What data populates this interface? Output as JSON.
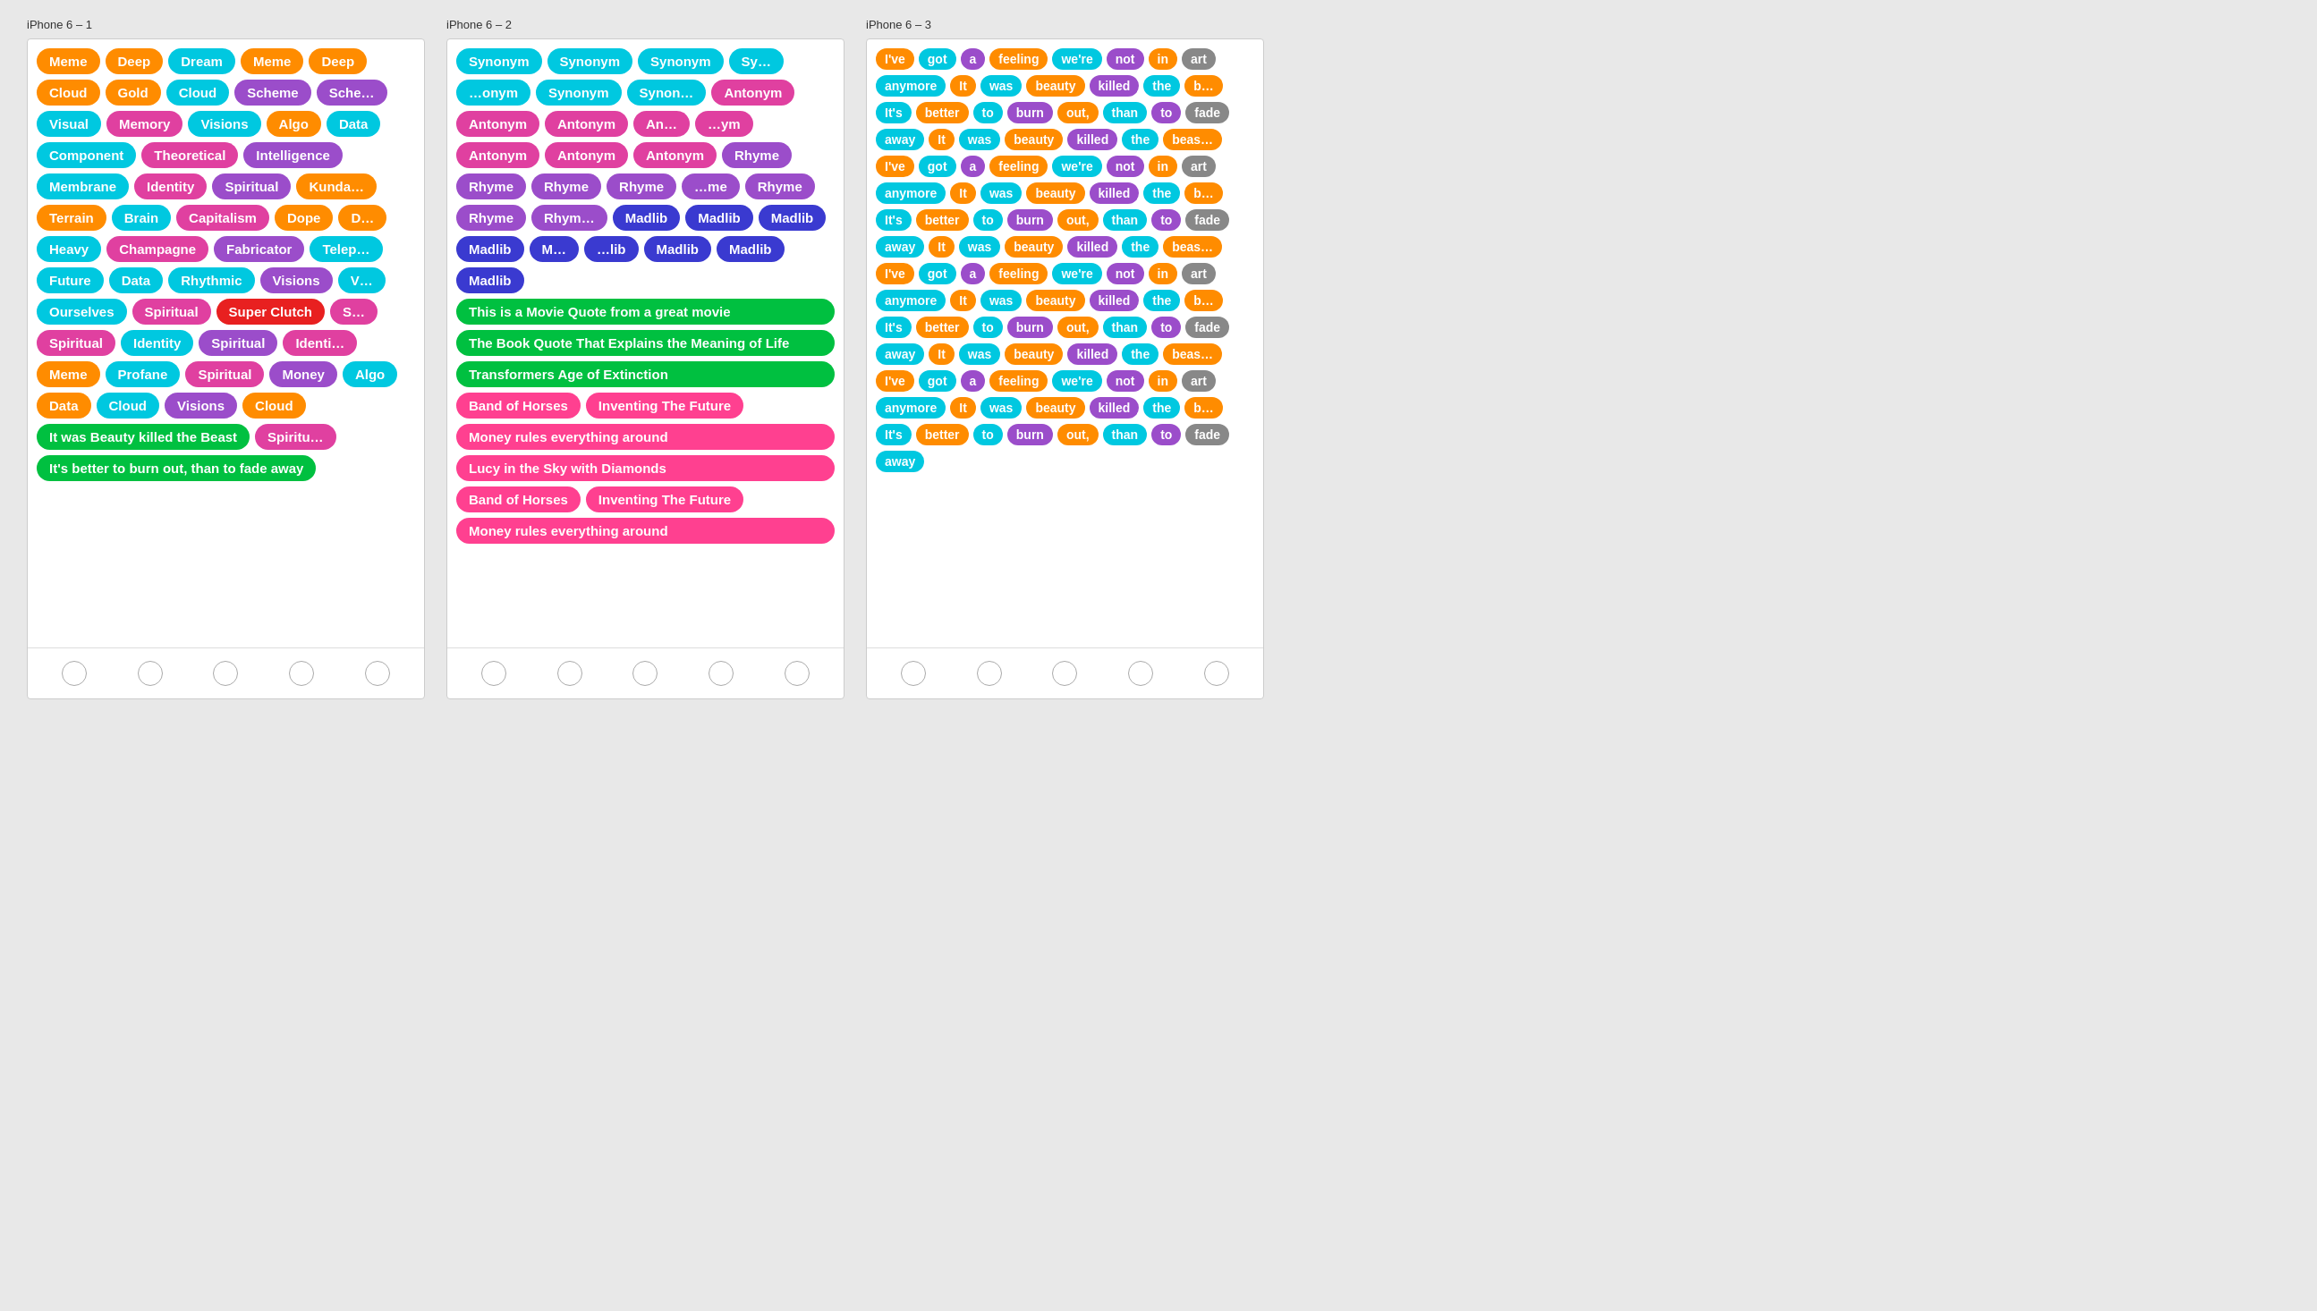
{
  "phones": [
    {
      "label": "iPhone 6 – 1",
      "tags": [
        {
          "text": "Meme",
          "color": "orange"
        },
        {
          "text": "Deep",
          "color": "orange"
        },
        {
          "text": "Dream",
          "color": "cyan"
        },
        {
          "text": "Meme",
          "color": "orange"
        },
        {
          "text": "Deep",
          "color": "orange"
        },
        {
          "text": "Cloud",
          "color": "orange"
        },
        {
          "text": "Gold",
          "color": "orange"
        },
        {
          "text": "Cloud",
          "color": "cyan"
        },
        {
          "text": "Scheme",
          "color": "purple"
        },
        {
          "text": "Sche…",
          "color": "purple"
        },
        {
          "text": "Visual",
          "color": "cyan"
        },
        {
          "text": "Memory",
          "color": "magenta"
        },
        {
          "text": "Visions",
          "color": "cyan"
        },
        {
          "text": "Algo",
          "color": "orange"
        },
        {
          "text": "Data",
          "color": "cyan"
        },
        {
          "text": "Component",
          "color": "cyan"
        },
        {
          "text": "Theoretical",
          "color": "magenta"
        },
        {
          "text": "Intelligence",
          "color": "purple"
        },
        {
          "text": "Membrane",
          "color": "cyan"
        },
        {
          "text": "Identity",
          "color": "magenta"
        },
        {
          "text": "Spiritual",
          "color": "purple"
        },
        {
          "text": "Kunda…",
          "color": "orange"
        },
        {
          "text": "Terrain",
          "color": "orange"
        },
        {
          "text": "Brain",
          "color": "cyan"
        },
        {
          "text": "Capitalism",
          "color": "magenta"
        },
        {
          "text": "Dope",
          "color": "orange"
        },
        {
          "text": "D…",
          "color": "orange"
        },
        {
          "text": "Heavy",
          "color": "cyan"
        },
        {
          "text": "Champagne",
          "color": "magenta"
        },
        {
          "text": "Fabricator",
          "color": "purple"
        },
        {
          "text": "Telep…",
          "color": "cyan"
        },
        {
          "text": "Future",
          "color": "cyan"
        },
        {
          "text": "Data",
          "color": "cyan"
        },
        {
          "text": "Rhythmic",
          "color": "cyan"
        },
        {
          "text": "Visions",
          "color": "purple"
        },
        {
          "text": "V…",
          "color": "cyan"
        },
        {
          "text": "Ourselves",
          "color": "cyan"
        },
        {
          "text": "Spiritual",
          "color": "magenta"
        },
        {
          "text": "Super Clutch",
          "color": "red"
        },
        {
          "text": "S…",
          "color": "magenta"
        },
        {
          "text": "Spiritual",
          "color": "magenta"
        },
        {
          "text": "Identity",
          "color": "cyan"
        },
        {
          "text": "Spiritual",
          "color": "purple"
        },
        {
          "text": "Identi…",
          "color": "magenta"
        },
        {
          "text": "Meme",
          "color": "orange"
        },
        {
          "text": "Profane",
          "color": "cyan"
        },
        {
          "text": "Spiritual",
          "color": "magenta"
        },
        {
          "text": "Money",
          "color": "purple"
        },
        {
          "text": "Algo",
          "color": "cyan"
        },
        {
          "text": "Data",
          "color": "orange"
        },
        {
          "text": "Cloud",
          "color": "cyan"
        },
        {
          "text": "Visions",
          "color": "purple"
        },
        {
          "text": "Cloud",
          "color": "orange"
        },
        {
          "text": "It was Beauty killed the Beast",
          "color": "green"
        },
        {
          "text": "Spiritu…",
          "color": "magenta"
        },
        {
          "text": "It's better to burn out, than to fade away",
          "color": "green"
        }
      ],
      "nav_dots": 5
    },
    {
      "label": "iPhone 6 – 2",
      "sections": [
        {
          "text": "Synonym",
          "color": "cyan",
          "type": "tag"
        },
        {
          "text": "Synonym",
          "color": "cyan",
          "type": "tag"
        },
        {
          "text": "Synonym",
          "color": "cyan",
          "type": "tag"
        },
        {
          "text": "Sy…",
          "color": "cyan",
          "type": "tag"
        },
        {
          "text": "…onym",
          "color": "cyan",
          "type": "tag"
        },
        {
          "text": "Synonym",
          "color": "cyan",
          "type": "tag"
        },
        {
          "text": "Synon…",
          "color": "cyan",
          "type": "tag"
        },
        {
          "text": "Antonym",
          "color": "magenta",
          "type": "tag"
        },
        {
          "text": "Antonym",
          "color": "magenta",
          "type": "tag"
        },
        {
          "text": "Antonym",
          "color": "magenta",
          "type": "tag"
        },
        {
          "text": "An…",
          "color": "magenta",
          "type": "tag"
        },
        {
          "text": "…ym",
          "color": "magenta",
          "type": "tag"
        },
        {
          "text": "Antonym",
          "color": "magenta",
          "type": "tag"
        },
        {
          "text": "Antonym",
          "color": "magenta",
          "type": "tag"
        },
        {
          "text": "Antonym",
          "color": "magenta",
          "type": "tag"
        },
        {
          "text": "Rhyme",
          "color": "purple",
          "type": "tag"
        },
        {
          "text": "Rhyme",
          "color": "purple",
          "type": "tag"
        },
        {
          "text": "Rhyme",
          "color": "purple",
          "type": "tag"
        },
        {
          "text": "Rhyme",
          "color": "purple",
          "type": "tag"
        },
        {
          "text": "…me",
          "color": "purple",
          "type": "tag"
        },
        {
          "text": "Rhyme",
          "color": "purple",
          "type": "tag"
        },
        {
          "text": "Rhyme",
          "color": "purple",
          "type": "tag"
        },
        {
          "text": "Rhym…",
          "color": "purple",
          "type": "tag"
        },
        {
          "text": "Madlib",
          "color": "darkblue",
          "type": "tag"
        },
        {
          "text": "Madlib",
          "color": "darkblue",
          "type": "tag"
        },
        {
          "text": "Madlib",
          "color": "darkblue",
          "type": "tag"
        },
        {
          "text": "Madlib",
          "color": "darkblue",
          "type": "tag"
        },
        {
          "text": "M…",
          "color": "darkblue",
          "type": "tag"
        },
        {
          "text": "…lib",
          "color": "darkblue",
          "type": "tag"
        },
        {
          "text": "Madlib",
          "color": "darkblue",
          "type": "tag"
        },
        {
          "text": "Madlib",
          "color": "darkblue",
          "type": "tag"
        },
        {
          "text": "Madlib",
          "color": "darkblue",
          "type": "tag"
        },
        {
          "text": "This is a Movie Quote from a great movie",
          "color": "green",
          "type": "long"
        },
        {
          "text": "The Book Quote That Explains the Meaning of Life",
          "color": "green",
          "type": "long"
        },
        {
          "text": "Transformers Age of Extinction",
          "color": "green",
          "type": "long"
        },
        {
          "text": "Band of Horses",
          "color": "pink",
          "type": "tag"
        },
        {
          "text": "Inventing The Future",
          "color": "pink",
          "type": "tag"
        },
        {
          "text": "Money rules everything around",
          "color": "pink",
          "type": "long"
        },
        {
          "text": "Lucy in the Sky with Diamonds",
          "color": "pink",
          "type": "long"
        },
        {
          "text": "Band of Horses",
          "color": "pink",
          "type": "tag"
        },
        {
          "text": "Inventing The Future",
          "color": "pink",
          "type": "tag"
        },
        {
          "text": "Money rules everything around",
          "color": "pink",
          "type": "long"
        }
      ],
      "nav_dots": 5
    }
  ],
  "phone3": {
    "label": "iPhone 6 – 3",
    "sentences": [
      {
        "words": [
          {
            "text": "I've",
            "color": "orange"
          },
          {
            "text": "got",
            "color": "cyan"
          },
          {
            "text": "a",
            "color": "purple"
          },
          {
            "text": "feeling",
            "color": "orange"
          },
          {
            "text": "we're",
            "color": "cyan"
          },
          {
            "text": "not",
            "color": "purple"
          },
          {
            "text": "in",
            "color": "orange"
          },
          {
            "text": "art"
          }
        ]
      },
      {
        "words": [
          {
            "text": "anymore",
            "color": "cyan"
          },
          {
            "text": "It",
            "color": "orange"
          },
          {
            "text": "was",
            "color": "cyan"
          },
          {
            "text": "beauty",
            "color": "orange"
          },
          {
            "text": "killed",
            "color": "purple"
          },
          {
            "text": "the",
            "color": "cyan"
          },
          {
            "text": "b…",
            "color": "orange"
          }
        ]
      },
      {
        "words": [
          {
            "text": "It's",
            "color": "cyan"
          },
          {
            "text": "better",
            "color": "orange"
          },
          {
            "text": "to",
            "color": "cyan"
          },
          {
            "text": "burn",
            "color": "purple"
          },
          {
            "text": "out,",
            "color": "orange"
          },
          {
            "text": "than",
            "color": "cyan"
          },
          {
            "text": "to",
            "color": "purple"
          },
          {
            "text": "fade"
          }
        ]
      },
      {
        "words": [
          {
            "text": "away",
            "color": "cyan"
          },
          {
            "text": "It",
            "color": "orange"
          },
          {
            "text": "was",
            "color": "cyan"
          },
          {
            "text": "beauty",
            "color": "orange"
          },
          {
            "text": "killed",
            "color": "purple"
          },
          {
            "text": "the",
            "color": "cyan"
          },
          {
            "text": "beas…",
            "color": "orange"
          }
        ]
      },
      {
        "words": [
          {
            "text": "I've",
            "color": "orange"
          },
          {
            "text": "got",
            "color": "cyan"
          },
          {
            "text": "a",
            "color": "purple"
          },
          {
            "text": "feeling",
            "color": "orange"
          },
          {
            "text": "we're",
            "color": "cyan"
          },
          {
            "text": "not",
            "color": "purple"
          },
          {
            "text": "in",
            "color": "orange"
          },
          {
            "text": "art"
          }
        ]
      },
      {
        "words": [
          {
            "text": "anymore",
            "color": "cyan"
          },
          {
            "text": "It",
            "color": "orange"
          },
          {
            "text": "was",
            "color": "cyan"
          },
          {
            "text": "beauty",
            "color": "orange"
          },
          {
            "text": "killed",
            "color": "purple"
          },
          {
            "text": "the",
            "color": "cyan"
          },
          {
            "text": "b…",
            "color": "orange"
          }
        ]
      },
      {
        "words": [
          {
            "text": "It's",
            "color": "cyan"
          },
          {
            "text": "better",
            "color": "orange"
          },
          {
            "text": "to",
            "color": "cyan"
          },
          {
            "text": "burn",
            "color": "purple"
          },
          {
            "text": "out,",
            "color": "orange"
          },
          {
            "text": "than",
            "color": "cyan"
          },
          {
            "text": "to",
            "color": "purple"
          },
          {
            "text": "fade"
          }
        ]
      },
      {
        "words": [
          {
            "text": "away",
            "color": "cyan"
          },
          {
            "text": "It",
            "color": "orange"
          },
          {
            "text": "was",
            "color": "cyan"
          },
          {
            "text": "beauty",
            "color": "orange"
          },
          {
            "text": "killed",
            "color": "purple"
          },
          {
            "text": "the",
            "color": "cyan"
          },
          {
            "text": "beas…",
            "color": "orange"
          }
        ]
      },
      {
        "words": [
          {
            "text": "I've",
            "color": "orange"
          },
          {
            "text": "got",
            "color": "cyan"
          },
          {
            "text": "a",
            "color": "purple"
          },
          {
            "text": "feeling",
            "color": "orange"
          },
          {
            "text": "we're",
            "color": "cyan"
          },
          {
            "text": "not",
            "color": "purple"
          },
          {
            "text": "in",
            "color": "orange"
          },
          {
            "text": "art"
          }
        ]
      },
      {
        "words": [
          {
            "text": "anymore",
            "color": "cyan"
          },
          {
            "text": "It",
            "color": "orange"
          },
          {
            "text": "was",
            "color": "cyan"
          },
          {
            "text": "beauty",
            "color": "orange"
          },
          {
            "text": "killed",
            "color": "purple"
          },
          {
            "text": "the",
            "color": "cyan"
          },
          {
            "text": "b…",
            "color": "orange"
          }
        ]
      },
      {
        "words": [
          {
            "text": "It's",
            "color": "cyan"
          },
          {
            "text": "better",
            "color": "orange"
          },
          {
            "text": "to",
            "color": "cyan"
          },
          {
            "text": "burn",
            "color": "purple"
          },
          {
            "text": "out,",
            "color": "orange"
          },
          {
            "text": "than",
            "color": "cyan"
          },
          {
            "text": "to",
            "color": "purple"
          },
          {
            "text": "fade"
          }
        ]
      },
      {
        "words": [
          {
            "text": "away",
            "color": "cyan"
          },
          {
            "text": "It",
            "color": "orange"
          },
          {
            "text": "was",
            "color": "cyan"
          },
          {
            "text": "beauty",
            "color": "orange"
          },
          {
            "text": "killed",
            "color": "purple"
          },
          {
            "text": "the",
            "color": "cyan"
          },
          {
            "text": "beas…",
            "color": "orange"
          }
        ]
      },
      {
        "words": [
          {
            "text": "I've",
            "color": "orange"
          },
          {
            "text": "got",
            "color": "cyan"
          },
          {
            "text": "a",
            "color": "purple"
          },
          {
            "text": "feeling",
            "color": "orange"
          },
          {
            "text": "we're",
            "color": "cyan"
          },
          {
            "text": "not",
            "color": "purple"
          },
          {
            "text": "in",
            "color": "orange"
          },
          {
            "text": "art"
          }
        ]
      },
      {
        "words": [
          {
            "text": "anymore",
            "color": "cyan"
          },
          {
            "text": "It",
            "color": "orange"
          },
          {
            "text": "was",
            "color": "cyan"
          },
          {
            "text": "beauty",
            "color": "orange"
          },
          {
            "text": "killed",
            "color": "purple"
          },
          {
            "text": "the",
            "color": "cyan"
          },
          {
            "text": "b…",
            "color": "orange"
          }
        ]
      },
      {
        "words": [
          {
            "text": "It's",
            "color": "cyan"
          },
          {
            "text": "better",
            "color": "orange"
          },
          {
            "text": "to",
            "color": "cyan"
          },
          {
            "text": "burn",
            "color": "purple"
          },
          {
            "text": "out,",
            "color": "orange"
          },
          {
            "text": "than",
            "color": "cyan"
          },
          {
            "text": "to",
            "color": "purple"
          },
          {
            "text": "fade"
          }
        ]
      },
      {
        "words": [
          {
            "text": "away",
            "color": "cyan"
          }
        ]
      }
    ],
    "nav_dots": 5
  },
  "colors": {
    "orange": "#FF8C00",
    "cyan": "#00C8E0",
    "purple": "#9B4DCA",
    "magenta": "#E040A0",
    "green": "#00C040",
    "red": "#E82020",
    "blue": "#2080E8",
    "darkblue": "#3A3AD0",
    "teal": "#00A0A0",
    "pink": "#FF4090"
  }
}
